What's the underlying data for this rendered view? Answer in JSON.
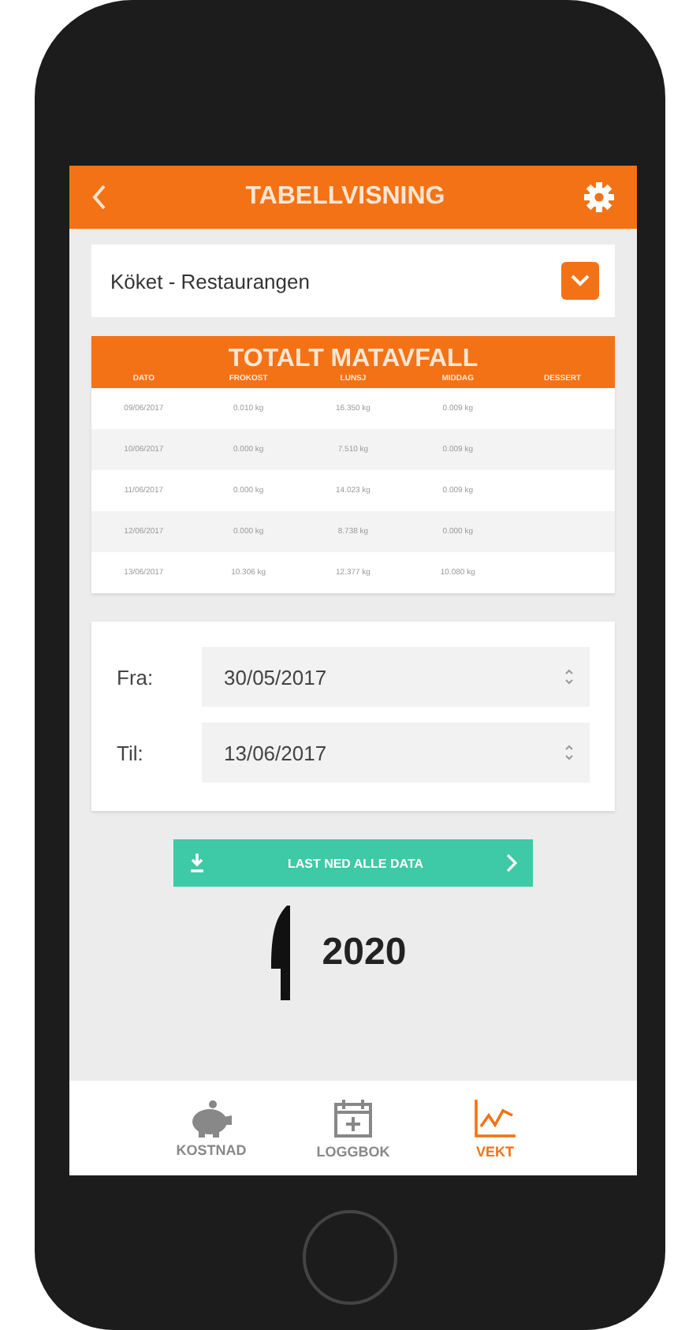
{
  "header": {
    "title": "TABELLVISNING"
  },
  "location_select": {
    "value": "Köket - Restaurangen"
  },
  "table": {
    "title": "TOTALT MATAVFALL",
    "columns": [
      "DATO",
      "FROKOST",
      "LUNSJ",
      "MIDDAG",
      "DESSERT"
    ],
    "rows": [
      {
        "cells": [
          "09/06/2017",
          "0.010 kg",
          "16.350 kg",
          "0.009 kg"
        ]
      },
      {
        "cells": [
          "10/06/2017",
          "0.000 kg",
          "7.510 kg",
          "0.009 kg"
        ]
      },
      {
        "cells": [
          "11/06/2017",
          "0.000 kg",
          "14.023 kg",
          "0.009 kg"
        ]
      },
      {
        "cells": [
          "12/06/2017",
          "0.000 kg",
          "8.738 kg",
          "0.000 kg"
        ]
      },
      {
        "cells": [
          "13/06/2017",
          "10.306 kg",
          "12.377 kg",
          "10.080 kg"
        ]
      }
    ]
  },
  "date_range": [
    {
      "label": "Fra:",
      "value": "30/05/2017"
    },
    {
      "label": "Til:",
      "value": "13/06/2017"
    }
  ],
  "download_button": {
    "label": "LAST NED ALLE DATA"
  },
  "logo": {
    "text": "2020"
  },
  "nav": [
    {
      "label": "KOSTNAD",
      "selected": false
    },
    {
      "label": "LOGGBOK",
      "selected": false
    },
    {
      "label": "VEKT",
      "selected": true
    }
  ]
}
